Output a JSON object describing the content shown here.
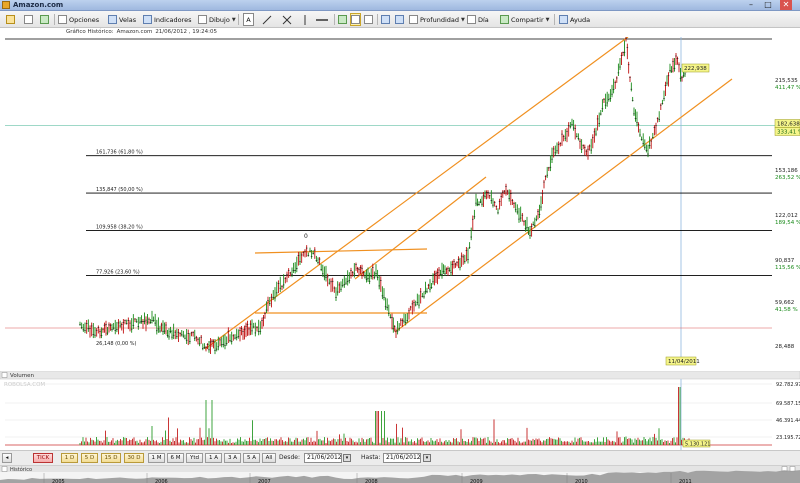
{
  "window": {
    "title": "Amazon.com",
    "close_label": "✕"
  },
  "toolbar": {
    "options_label": "Opciones",
    "candles_label": "Velas",
    "indicators_label": "Indicadores",
    "drawing_label": "Dibujo",
    "depth_label": "Profundidad",
    "interval_label": "Día",
    "share_label": "Compartir",
    "help_label": "Ayuda",
    "text_tool_label": "A"
  },
  "info_bar": {
    "label": "Gráfico Histórico:",
    "symbol": "Amazon.com",
    "datetime": "21/06/2012 , 19:24:05"
  },
  "chart_data": [
    {
      "type": "line",
      "title": "",
      "y_axis_labels": [
        "215,535",
        "153,186",
        "122,012",
        "90,837",
        "59,662",
        "28,488"
      ],
      "y_percent_labels": [
        "411,47 %",
        "263,52 %",
        "189,54 %",
        "115,56 %",
        "41,58 %"
      ],
      "fibonacci_levels": [
        {
          "label": "161,736 (61,80 %)",
          "value": 161.736
        },
        {
          "label": "135,847 (50,00 %)",
          "value": 135.847
        },
        {
          "label": "109,958 (38,20 %)",
          "value": 109.958
        },
        {
          "label": "77,926 (23,60 %)",
          "value": 77.926
        },
        {
          "label": "26,148 (0,00 %)",
          "value": 26.148
        }
      ],
      "price_flags": [
        {
          "label": "222,938",
          "value": 222.938
        },
        {
          "label": "182,638",
          "value": 182.638
        },
        {
          "label": "333,41 %",
          "value": 182.638
        }
      ],
      "cursor_date_label": "11/04/2011",
      "annotation_marker": "0",
      "colors": {
        "up": "#1a8a1a",
        "down": "#c01010",
        "channel": "#f09020",
        "fib": "#000000"
      }
    },
    {
      "type": "bar",
      "title": "Volumen",
      "watermark": "ROBOLSA.COM",
      "y_axis_labels": [
        "92.782.970",
        "69.587.150",
        "46.391.440",
        "23.195.720"
      ],
      "last_value_label": "5.130.121"
    }
  ],
  "range_bar": {
    "tick_label": "TICK",
    "buttons": [
      "1 D",
      "5 D",
      "15 D",
      "30 D",
      "1 M",
      "6 M",
      "Ytd",
      "1 A",
      "3 A",
      "5 A",
      "All"
    ],
    "from_label": "Desde:",
    "from_value": "21/06/2012",
    "to_label": "Hasta:",
    "to_value": "21/06/2012"
  },
  "history": {
    "label": "Histórico",
    "years": [
      "2005",
      "2006",
      "2007",
      "2008",
      "2009",
      "2010",
      "2011"
    ]
  }
}
